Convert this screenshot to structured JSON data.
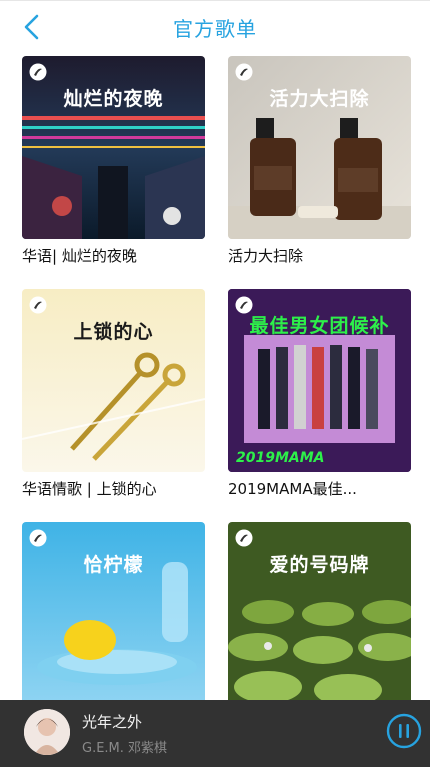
{
  "header": {
    "title": "官方歌单",
    "back_icon": "chevron-left-icon",
    "accent_color": "#27a3e0"
  },
  "playlists": [
    {
      "cover_title": "灿烂的夜晚",
      "label": "华语| 灿烂的夜晚"
    },
    {
      "cover_title": "活力大扫除",
      "label": "活力大扫除"
    },
    {
      "cover_title": "上锁的心",
      "label": "华语情歌 | 上锁的心"
    },
    {
      "cover_title": "最佳男女团候补",
      "label": "2019MAMA最佳...",
      "cover_caption": "2019MAMA"
    },
    {
      "cover_title": "恰柠檬",
      "label": ""
    },
    {
      "cover_title": "爱的号码牌",
      "label": ""
    }
  ],
  "player": {
    "title": "光年之外",
    "artist": "G.E.M. 邓紫棋",
    "pause_icon": "pause-icon",
    "background_color": "#323232"
  }
}
